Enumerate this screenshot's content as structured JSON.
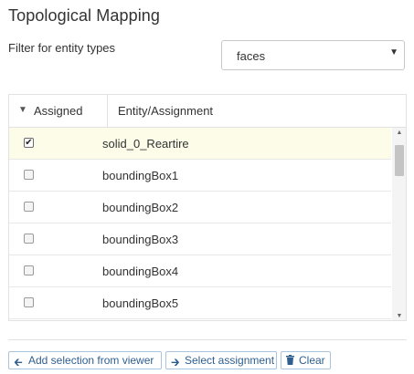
{
  "panel": {
    "title": "Topological Mapping",
    "filter_label": "Filter for entity types",
    "filter_value": "faces"
  },
  "table": {
    "headers": {
      "assigned": "Assigned",
      "entity": "Entity/Assignment"
    },
    "rows": [
      {
        "name": "solid_0_Reartire",
        "checked": true
      },
      {
        "name": "boundingBox1",
        "checked": false
      },
      {
        "name": "boundingBox2",
        "checked": false
      },
      {
        "name": "boundingBox3",
        "checked": false
      },
      {
        "name": "boundingBox4",
        "checked": false
      },
      {
        "name": "boundingBox5",
        "checked": false
      }
    ]
  },
  "icons": {
    "sort": "sort-desc-icon",
    "select_caret": "caret-down-icon",
    "add": "arrow-left-icon",
    "select": "arrow-right-icon",
    "clear": "trash-icon"
  },
  "buttons": {
    "add": "Add selection from viewer",
    "select": "Select assignment",
    "clear": "Clear"
  },
  "colors": {
    "selected_row": "#fcfce8",
    "button_text": "#2f5f8f",
    "button_border": "#a9c4de"
  }
}
